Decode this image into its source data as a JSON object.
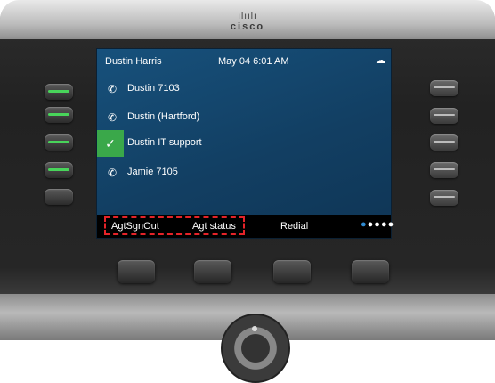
{
  "device": {
    "brand": "cisco",
    "logo_bars": "ılıılı",
    "accent_color": "#3aa84a",
    "highlight_color": "#e52329"
  },
  "status_bar": {
    "user": "Dustin Harris",
    "datetime": "May 04 6:01 AM",
    "icon": "cloud-icon"
  },
  "lines": [
    {
      "label": "Dustin 7103",
      "icon": "phone-icon",
      "selected": false
    },
    {
      "label": "Dustin (Hartford)",
      "icon": "phone-icon",
      "selected": false
    },
    {
      "label": "Dustin IT support",
      "icon": "check-icon",
      "selected": true
    },
    {
      "label": "Jamie 7105",
      "icon": "phone-icon",
      "selected": false
    }
  ],
  "softkeys": [
    {
      "label": "AgtSgnOut"
    },
    {
      "label": "Agt status"
    },
    {
      "label": "Redial"
    }
  ],
  "softkey_pages": {
    "total": 5,
    "current": 1
  }
}
